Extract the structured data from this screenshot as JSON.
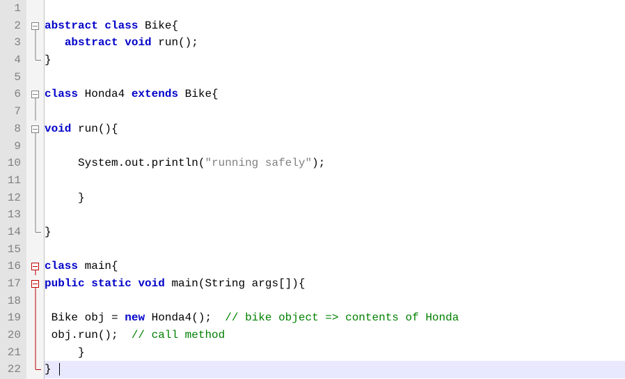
{
  "line_numbers": [
    "1",
    "2",
    "3",
    "4",
    "5",
    "6",
    "7",
    "8",
    "9",
    "10",
    "11",
    "12",
    "13",
    "14",
    "15",
    "16",
    "17",
    "18",
    "19",
    "20",
    "21",
    "22"
  ],
  "code": {
    "l2": {
      "kw1": "abstract",
      "kw2": "class",
      "t1": " Bike{"
    },
    "l3": {
      "pad": "   ",
      "kw1": "abstract",
      "kw2": "void",
      "t1": " run();"
    },
    "l4": {
      "t1": "}"
    },
    "l6": {
      "kw1": "class",
      "t1": " Honda4 ",
      "kw2": "extends",
      "t2": " Bike{"
    },
    "l8": {
      "kw1": "void",
      "t1": " run(){"
    },
    "l10": {
      "pad": "     ",
      "t1": "System.out.println(",
      "str": "\"running safely\"",
      "t2": ");"
    },
    "l12": {
      "pad": "     ",
      "t1": "}"
    },
    "l14": {
      "t1": "}"
    },
    "l16": {
      "kw1": "class",
      "t1": " main{"
    },
    "l17": {
      "kw1": "public",
      "kw2": "static",
      "kw3": "void",
      "t1": " main(String args[]){"
    },
    "l19": {
      "pad": " ",
      "t1": "Bike obj = ",
      "kw1": "new",
      "t2": " Honda4();  ",
      "cmt": "// bike object => contents of Honda"
    },
    "l20": {
      "pad": " ",
      "t1": "obj.run();  ",
      "cmt": "// call method"
    },
    "l21": {
      "pad": "     ",
      "t1": "}"
    },
    "l22": {
      "t1": "} "
    }
  }
}
